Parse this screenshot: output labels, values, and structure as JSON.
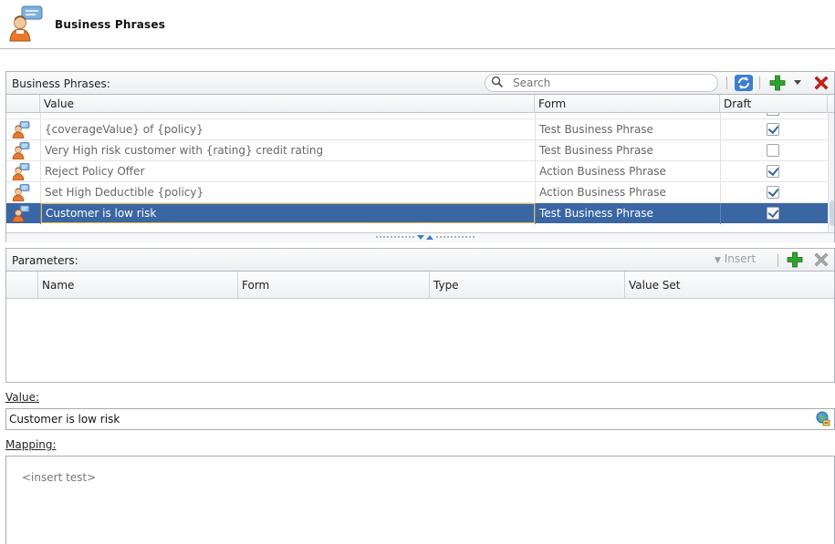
{
  "header": {
    "title": "Business Phrases",
    "icon": "business-phrase-person-icon"
  },
  "phrases_panel": {
    "label": "Business Phrases:",
    "search_placeholder": "Search",
    "columns": [
      "Value",
      "Form",
      "Draft"
    ],
    "rows": [
      {
        "value": "{coverageValue} of {policy}",
        "form": "Test Business Phrase",
        "draft": true,
        "selected": false
      },
      {
        "value": "Very High risk customer with {rating} credit rating",
        "form": "Test Business Phrase",
        "draft": false,
        "selected": false
      },
      {
        "value": "Reject Policy Offer",
        "form": "Action Business Phrase",
        "draft": true,
        "selected": false
      },
      {
        "value": "Set High Deductible {policy}",
        "form": "Action Business Phrase",
        "draft": true,
        "selected": false
      },
      {
        "value": "Customer is low risk",
        "form": "Test Business Phrase",
        "draft": true,
        "selected": true
      }
    ]
  },
  "parameters_panel": {
    "label": "Parameters:",
    "insert_label": "Insert",
    "columns": [
      "Name",
      "Form",
      "Type",
      "Value Set"
    ]
  },
  "value_section": {
    "label": "Value:",
    "value": "Customer is low risk"
  },
  "mapping_section": {
    "label": "Mapping:",
    "placeholder": "<insert test>"
  },
  "colors": {
    "selection": "#3a66a3",
    "add_green": "#2fa32f",
    "delete_red": "#d32020",
    "focus_border": "#e8b84a"
  }
}
